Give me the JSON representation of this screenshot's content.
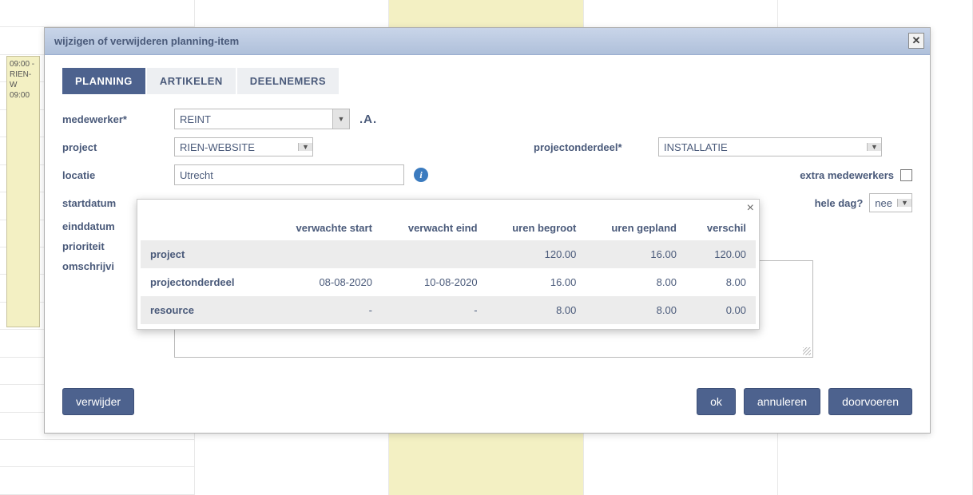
{
  "bg_event": {
    "line1": "09:00 -",
    "line2": "RIEN-W",
    "line3": "09:00"
  },
  "dialog": {
    "title": "wijzigen of verwijderen planning-item",
    "tabs": [
      "PLANNING",
      "ARTIKELEN",
      "DEELNEMERS"
    ],
    "active_tab": 0,
    "fields": {
      "medewerker_label": "medewerker*",
      "medewerker_value": "REINT",
      "project_label": "project",
      "project_value": "RIEN-WEBSITE",
      "projectonderdeel_label": "projectonderdeel*",
      "projectonderdeel_value": "INSTALLATIE",
      "locatie_label": "locatie",
      "locatie_value": "Utrecht",
      "extra_medewerkers_label": "extra medewerkers",
      "startdatum_label": "startdatum",
      "einddatum_label": "einddatum",
      "hele_dag_label": "hele dag?",
      "hele_dag_value": "nee",
      "prioriteit_label": "prioriteit",
      "omschrijving_label": "omschrijvi"
    },
    "buttons": {
      "verwijder": "verwijder",
      "ok": "ok",
      "annuleren": "annuleren",
      "doorvoeren": "doorvoeren"
    }
  },
  "popover": {
    "headers": [
      "",
      "verwachte start",
      "verwacht eind",
      "uren begroot",
      "uren gepland",
      "verschil"
    ],
    "rows": [
      {
        "label": "project",
        "vstart": "",
        "veind": "",
        "begroot": "120.00",
        "gepland": "16.00",
        "verschil": "120.00"
      },
      {
        "label": "projectonderdeel",
        "vstart": "08-08-2020",
        "veind": "10-08-2020",
        "begroot": "16.00",
        "gepland": "8.00",
        "verschil": "8.00"
      },
      {
        "label": "resource",
        "vstart": "-",
        "veind": "-",
        "begroot": "8.00",
        "gepland": "8.00",
        "verschil": "0.00"
      }
    ]
  }
}
